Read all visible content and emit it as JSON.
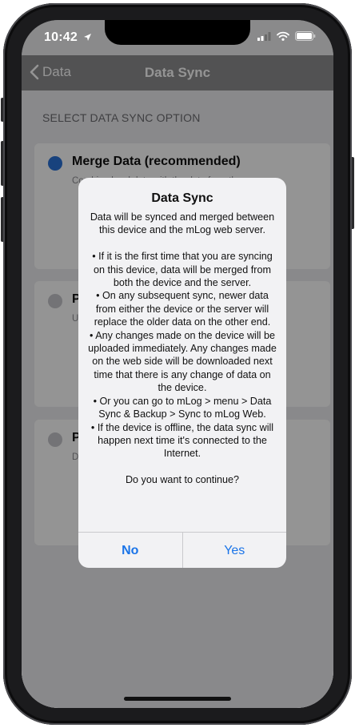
{
  "status_bar": {
    "time": "10:42"
  },
  "nav": {
    "back_label": "Data",
    "title": "Data Sync"
  },
  "section_header": "SELECT DATA SYNC OPTION",
  "options": [
    {
      "title": "Merge Data (recommended)",
      "description": "Combine local data with the data from the",
      "selected": true
    },
    {
      "title": "P",
      "description": "U",
      "selected": false
    },
    {
      "title": "P",
      "description": "D",
      "selected": false
    }
  ],
  "dialog": {
    "title": "Data Sync",
    "message": "Data will be synced and merged between this device and the mLog web server.\n\n• If it is the first time that you are syncing on this device, data will be merged from both the device and the server.\n• On any subsequent sync, newer data from either the device or the server will replace the older data on the other end.\n• Any changes made on the device will be uploaded immediately. Any changes made on the web side will be downloaded next time that there is any change of data on the device.\n• Or you can go to mLog > menu > Data Sync & Backup > Sync to mLog Web.\n• If the device is offline, the data sync will happen next time it's connected to the Internet.\n\nDo you want to continue?",
    "no_label": "No",
    "yes_label": "Yes"
  },
  "colors": {
    "accent": "#1a74e8",
    "selected_radio": "#2a72d8",
    "nav_bar": "#8e8e90"
  }
}
